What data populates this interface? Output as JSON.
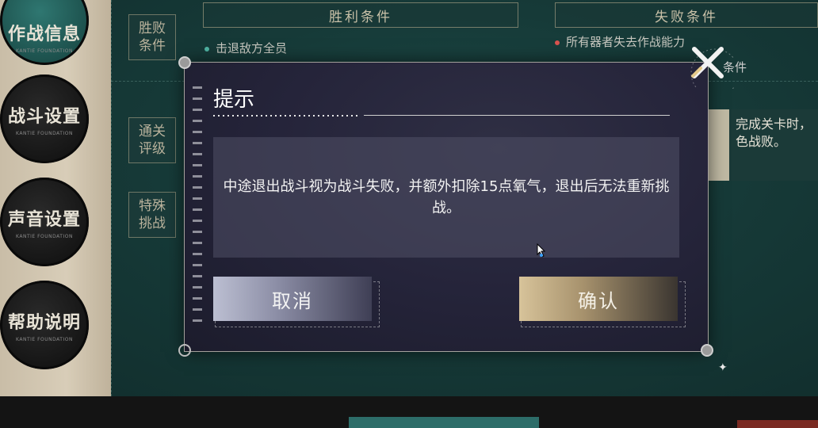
{
  "side_menu": {
    "items": [
      {
        "label": "作战信息",
        "sub": "KANTIE FOUNDATION",
        "active": true
      },
      {
        "label": "战斗设置",
        "sub": "KANTIE FOUNDATION",
        "active": false
      },
      {
        "label": "声音设置",
        "sub": "KANTIE FOUNDATION",
        "active": false
      },
      {
        "label": "帮助说明",
        "sub": "KANTIE FOUNDATION",
        "active": false
      }
    ]
  },
  "conditions": {
    "categories": [
      "胜败条件",
      "通关评级",
      "特殊挑战"
    ],
    "victory_header": "胜利条件",
    "defeat_header": "失败条件",
    "victory_item": "击退敌方全员",
    "defeat_item": "所有器者失去作战能力",
    "defeat_item_partial": "条件",
    "rating_text": "完成关卡时，色战败。"
  },
  "dialog": {
    "title": "提示",
    "message": "中途退出战斗视为战斗失败，并额外扣除15点氧气，退出后无法重新挑战。",
    "cancel_label": "取消",
    "confirm_label": "确认"
  },
  "colors": {
    "accent_teal": "#2f7771",
    "dialog_bg": "#25243a",
    "cancel_button": "#8c8ea6",
    "confirm_button": "#a7926d"
  },
  "icons": [
    "close-icon",
    "cursor-icon",
    "sparkle-icon"
  ]
}
